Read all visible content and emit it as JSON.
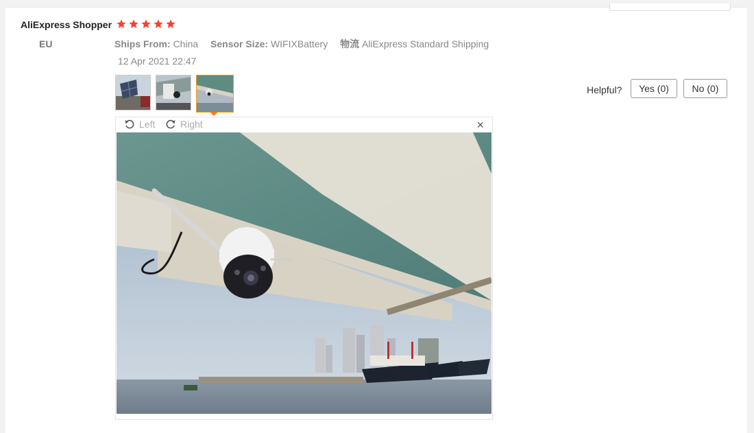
{
  "review": {
    "reviewer_name": "AliExpress Shopper",
    "country": "EU",
    "rating": 5,
    "ships_from_label": "Ships From:",
    "ships_from_value": "China",
    "sensor_label": "Sensor Size:",
    "sensor_value": "WIFIXBattery",
    "logistics_label": "物流",
    "logistics_value": "AliExpress Standard Shipping",
    "date": "12 Apr 2021 22:47"
  },
  "helpful": {
    "label": "Helpful?",
    "yes": "Yes (0)",
    "no": "No (0)"
  },
  "viewer": {
    "rotate_left": "Left",
    "rotate_right": "Right",
    "close": "×"
  },
  "colors": {
    "star": "#f44336",
    "active_thumb": "#f4a000",
    "arrow": "#f47a1e"
  }
}
